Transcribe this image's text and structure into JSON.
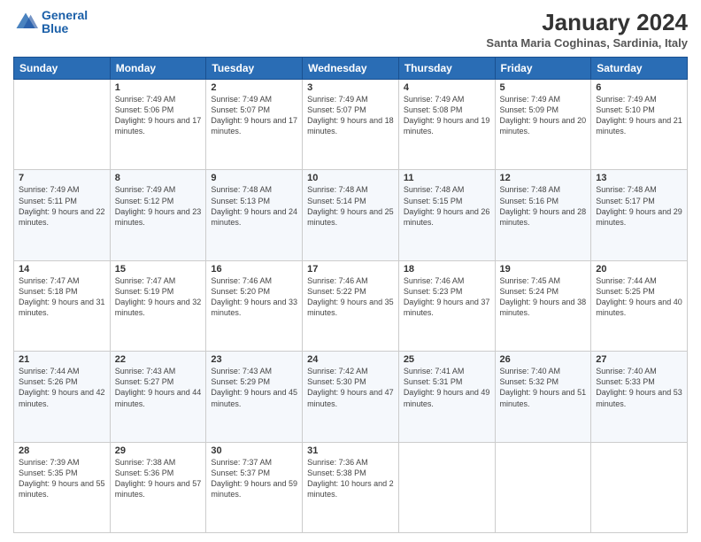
{
  "logo": {
    "line1": "General",
    "line2": "Blue"
  },
  "title": "January 2024",
  "subtitle": "Santa Maria Coghinas, Sardinia, Italy",
  "days": [
    "Sunday",
    "Monday",
    "Tuesday",
    "Wednesday",
    "Thursday",
    "Friday",
    "Saturday"
  ],
  "weeks": [
    [
      {
        "day": "",
        "sunrise": "",
        "sunset": "",
        "daylight": ""
      },
      {
        "day": "1",
        "sunrise": "Sunrise: 7:49 AM",
        "sunset": "Sunset: 5:06 PM",
        "daylight": "Daylight: 9 hours and 17 minutes."
      },
      {
        "day": "2",
        "sunrise": "Sunrise: 7:49 AM",
        "sunset": "Sunset: 5:07 PM",
        "daylight": "Daylight: 9 hours and 17 minutes."
      },
      {
        "day": "3",
        "sunrise": "Sunrise: 7:49 AM",
        "sunset": "Sunset: 5:07 PM",
        "daylight": "Daylight: 9 hours and 18 minutes."
      },
      {
        "day": "4",
        "sunrise": "Sunrise: 7:49 AM",
        "sunset": "Sunset: 5:08 PM",
        "daylight": "Daylight: 9 hours and 19 minutes."
      },
      {
        "day": "5",
        "sunrise": "Sunrise: 7:49 AM",
        "sunset": "Sunset: 5:09 PM",
        "daylight": "Daylight: 9 hours and 20 minutes."
      },
      {
        "day": "6",
        "sunrise": "Sunrise: 7:49 AM",
        "sunset": "Sunset: 5:10 PM",
        "daylight": "Daylight: 9 hours and 21 minutes."
      }
    ],
    [
      {
        "day": "7",
        "sunrise": "Sunrise: 7:49 AM",
        "sunset": "Sunset: 5:11 PM",
        "daylight": "Daylight: 9 hours and 22 minutes."
      },
      {
        "day": "8",
        "sunrise": "Sunrise: 7:49 AM",
        "sunset": "Sunset: 5:12 PM",
        "daylight": "Daylight: 9 hours and 23 minutes."
      },
      {
        "day": "9",
        "sunrise": "Sunrise: 7:48 AM",
        "sunset": "Sunset: 5:13 PM",
        "daylight": "Daylight: 9 hours and 24 minutes."
      },
      {
        "day": "10",
        "sunrise": "Sunrise: 7:48 AM",
        "sunset": "Sunset: 5:14 PM",
        "daylight": "Daylight: 9 hours and 25 minutes."
      },
      {
        "day": "11",
        "sunrise": "Sunrise: 7:48 AM",
        "sunset": "Sunset: 5:15 PM",
        "daylight": "Daylight: 9 hours and 26 minutes."
      },
      {
        "day": "12",
        "sunrise": "Sunrise: 7:48 AM",
        "sunset": "Sunset: 5:16 PM",
        "daylight": "Daylight: 9 hours and 28 minutes."
      },
      {
        "day": "13",
        "sunrise": "Sunrise: 7:48 AM",
        "sunset": "Sunset: 5:17 PM",
        "daylight": "Daylight: 9 hours and 29 minutes."
      }
    ],
    [
      {
        "day": "14",
        "sunrise": "Sunrise: 7:47 AM",
        "sunset": "Sunset: 5:18 PM",
        "daylight": "Daylight: 9 hours and 31 minutes."
      },
      {
        "day": "15",
        "sunrise": "Sunrise: 7:47 AM",
        "sunset": "Sunset: 5:19 PM",
        "daylight": "Daylight: 9 hours and 32 minutes."
      },
      {
        "day": "16",
        "sunrise": "Sunrise: 7:46 AM",
        "sunset": "Sunset: 5:20 PM",
        "daylight": "Daylight: 9 hours and 33 minutes."
      },
      {
        "day": "17",
        "sunrise": "Sunrise: 7:46 AM",
        "sunset": "Sunset: 5:22 PM",
        "daylight": "Daylight: 9 hours and 35 minutes."
      },
      {
        "day": "18",
        "sunrise": "Sunrise: 7:46 AM",
        "sunset": "Sunset: 5:23 PM",
        "daylight": "Daylight: 9 hours and 37 minutes."
      },
      {
        "day": "19",
        "sunrise": "Sunrise: 7:45 AM",
        "sunset": "Sunset: 5:24 PM",
        "daylight": "Daylight: 9 hours and 38 minutes."
      },
      {
        "day": "20",
        "sunrise": "Sunrise: 7:44 AM",
        "sunset": "Sunset: 5:25 PM",
        "daylight": "Daylight: 9 hours and 40 minutes."
      }
    ],
    [
      {
        "day": "21",
        "sunrise": "Sunrise: 7:44 AM",
        "sunset": "Sunset: 5:26 PM",
        "daylight": "Daylight: 9 hours and 42 minutes."
      },
      {
        "day": "22",
        "sunrise": "Sunrise: 7:43 AM",
        "sunset": "Sunset: 5:27 PM",
        "daylight": "Daylight: 9 hours and 44 minutes."
      },
      {
        "day": "23",
        "sunrise": "Sunrise: 7:43 AM",
        "sunset": "Sunset: 5:29 PM",
        "daylight": "Daylight: 9 hours and 45 minutes."
      },
      {
        "day": "24",
        "sunrise": "Sunrise: 7:42 AM",
        "sunset": "Sunset: 5:30 PM",
        "daylight": "Daylight: 9 hours and 47 minutes."
      },
      {
        "day": "25",
        "sunrise": "Sunrise: 7:41 AM",
        "sunset": "Sunset: 5:31 PM",
        "daylight": "Daylight: 9 hours and 49 minutes."
      },
      {
        "day": "26",
        "sunrise": "Sunrise: 7:40 AM",
        "sunset": "Sunset: 5:32 PM",
        "daylight": "Daylight: 9 hours and 51 minutes."
      },
      {
        "day": "27",
        "sunrise": "Sunrise: 7:40 AM",
        "sunset": "Sunset: 5:33 PM",
        "daylight": "Daylight: 9 hours and 53 minutes."
      }
    ],
    [
      {
        "day": "28",
        "sunrise": "Sunrise: 7:39 AM",
        "sunset": "Sunset: 5:35 PM",
        "daylight": "Daylight: 9 hours and 55 minutes."
      },
      {
        "day": "29",
        "sunrise": "Sunrise: 7:38 AM",
        "sunset": "Sunset: 5:36 PM",
        "daylight": "Daylight: 9 hours and 57 minutes."
      },
      {
        "day": "30",
        "sunrise": "Sunrise: 7:37 AM",
        "sunset": "Sunset: 5:37 PM",
        "daylight": "Daylight: 9 hours and 59 minutes."
      },
      {
        "day": "31",
        "sunrise": "Sunrise: 7:36 AM",
        "sunset": "Sunset: 5:38 PM",
        "daylight": "Daylight: 10 hours and 2 minutes."
      },
      {
        "day": "",
        "sunrise": "",
        "sunset": "",
        "daylight": ""
      },
      {
        "day": "",
        "sunrise": "",
        "sunset": "",
        "daylight": ""
      },
      {
        "day": "",
        "sunrise": "",
        "sunset": "",
        "daylight": ""
      }
    ]
  ]
}
